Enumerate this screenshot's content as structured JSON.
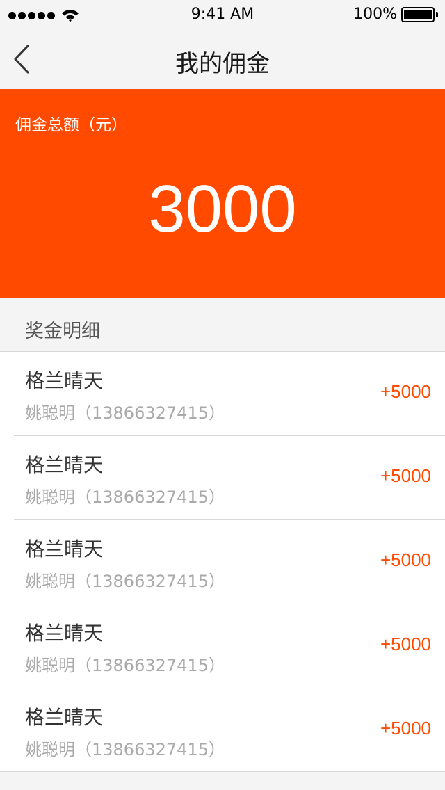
{
  "status_bar": {
    "time": "9:41 AM",
    "battery": "100%",
    "battery_level": 1.0
  },
  "nav": {
    "title": "我的佣金",
    "back_icon": "chevron-left-icon"
  },
  "summary": {
    "label": "佣金总额（元）",
    "amount": "3000"
  },
  "section": {
    "title": "奖金明细"
  },
  "records": [
    {
      "title": "格兰晴天",
      "subtitle": "姚聪明（13866327415）",
      "amount": "+5000"
    },
    {
      "title": "格兰晴天",
      "subtitle": "姚聪明（13866327415）",
      "amount": "+5000"
    },
    {
      "title": "格兰晴天",
      "subtitle": "姚聪明（13866327415）",
      "amount": "+5000"
    },
    {
      "title": "格兰晴天",
      "subtitle": "姚聪明（13866327415）",
      "amount": "+5000"
    },
    {
      "title": "格兰晴天",
      "subtitle": "姚聪明（13866327415）",
      "amount": "+5000"
    }
  ],
  "colors": {
    "accent": "#ff4a00",
    "background": "#f4f4f4"
  }
}
